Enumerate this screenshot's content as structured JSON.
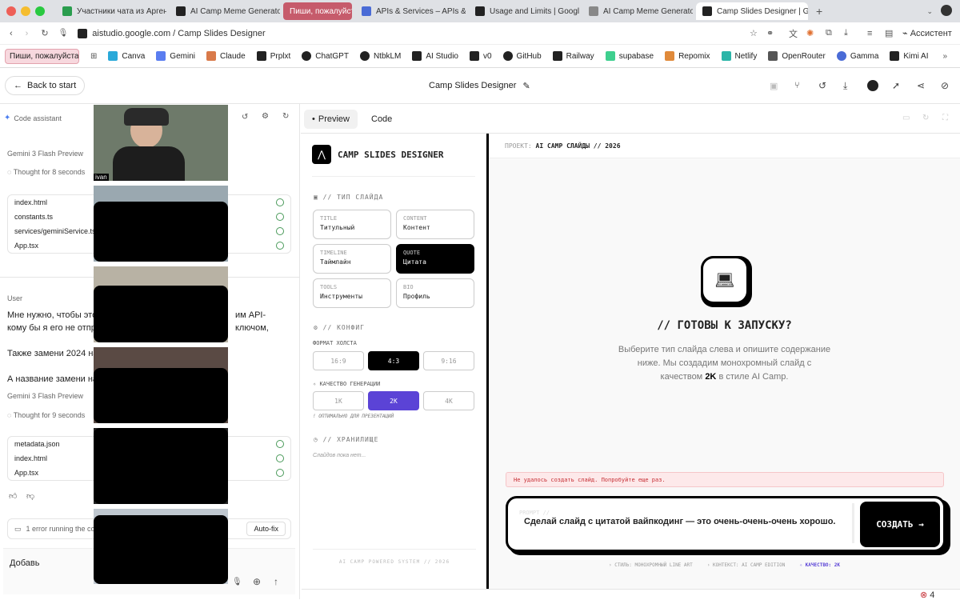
{
  "browser": {
    "tabs": [
      {
        "label": "Участники чата из Аргентин",
        "color": "#2a9d4e"
      },
      {
        "label": "AI Camp Meme Generator | G",
        "color": "#222"
      },
      {
        "label": "Пиши, пожалуйста",
        "color": "#c8324a"
      },
      {
        "label": "APIs & Services – APIs & Se",
        "color": "#4a6bd6"
      },
      {
        "label": "Usage and Limits | Google A",
        "color": "#222"
      },
      {
        "label": "AI Camp Meme Generator",
        "color": "#888"
      },
      {
        "label": "Camp Slides Designer | Goo",
        "color": "#222"
      }
    ],
    "new_tab": "+",
    "url": "aistudio.google.com / Camp Slides Designer",
    "assistant_label": "Ассистент",
    "bookmarks": [
      {
        "label": "Пиши, пожалуйста,...",
        "color": "#f3c9d0"
      },
      {
        "label": "Canva",
        "color": "#2aa9d9"
      },
      {
        "label": "Gemini",
        "color": "#5a7df0"
      },
      {
        "label": "Claude",
        "color": "#d97a4a"
      },
      {
        "label": "Prplxt",
        "color": "#222"
      },
      {
        "label": "ChatGPT",
        "color": "#222"
      },
      {
        "label": "NtbkLM",
        "color": "#222"
      },
      {
        "label": "AI Studio",
        "color": "#222"
      },
      {
        "label": "v0",
        "color": "#222"
      },
      {
        "label": "GitHub",
        "color": "#222"
      },
      {
        "label": "Railway",
        "color": "#222"
      },
      {
        "label": "supabase",
        "color": "#3ecf8e"
      },
      {
        "label": "Repomix",
        "color": "#e08a3a"
      },
      {
        "label": "Netlify",
        "color": "#2bb5a8"
      },
      {
        "label": "OpenRouter",
        "color": "#555"
      },
      {
        "label": "Gamma",
        "color": "#4a6bd6"
      },
      {
        "label": "Kimi AI",
        "color": "#222"
      }
    ]
  },
  "header": {
    "back_label": "Back to start",
    "title": "Camp Slides Designer"
  },
  "left": {
    "code_assistant": "Code assistant",
    "model1": "Gemini 3 Flash Preview",
    "thought1": "Thought for 8 seconds",
    "files1": [
      "index.html",
      "constants.ts",
      "services/geminiService.ts",
      "App.tsx"
    ],
    "user_label": "User",
    "msg1a": "Мне нужно, чтобы это",
    "msg1b": "им API-ключом,",
    "msg2": "кому бы я его не отпра",
    "msg3": "Также замени 2024 на 2026, сейчас 26-й год.",
    "msg4": "А название замени на",
    "model2": "Gemini 3 Flash Preview",
    "thought2": "Thought for 9 seconds",
    "files2": [
      "metadata.json",
      "index.html",
      "App.tsx"
    ],
    "error_text": "1 error running the co",
    "autofix": "Auto-fix",
    "input_value": "Добавь",
    "video_name": "ivan"
  },
  "center": {
    "tab_preview": "Preview",
    "tab_code": "Code",
    "app_title": "CAMP SLIDES DESIGNER",
    "section_type": "// ТИП СЛАЙДА",
    "slide_types": [
      {
        "tag": "TITLE",
        "label": "Титульный"
      },
      {
        "tag": "CONTENT",
        "label": "Контент"
      },
      {
        "tag": "TIMELINE",
        "label": "Таймлайн"
      },
      {
        "tag": "QUOTE",
        "label": "Цитата"
      },
      {
        "tag": "TOOLS",
        "label": "Инструменты"
      },
      {
        "tag": "BIO",
        "label": "Профиль"
      }
    ],
    "section_config": "// КОНФИГ",
    "canvas_label": "ФОРМАТ ХОЛСТА",
    "formats": [
      "16:9",
      "4:3",
      "9:16"
    ],
    "quality_label": "КАЧЕСТВО ГЕНЕРАЦИИ",
    "qualities": [
      "1K",
      "2K",
      "4K"
    ],
    "quality_hint": "! ОПТИМАЛЬНО ДЛЯ ПРЕЗЕНТАЦИЙ",
    "section_storage": "// ХРАНИЛИЩЕ",
    "storage_empty": "Слайдов пока нет...",
    "footer": "AI CAMP POWERED SYSTEM // 2026",
    "project_label": "ПРОЕКТ:",
    "project_value": "AI CAMP СЛАЙДЫ // 2026",
    "ready_title": "// ГОТОВЫ К ЗАПУСКУ?",
    "ready_desc1": "Выберите тип слайда слева и опишите содержание",
    "ready_desc2": "ниже. Мы создадим монохромный слайд с",
    "ready_desc3a": "качеством",
    "ready_desc3b": "2K",
    "ready_desc3c": "в стиле AI Camp.",
    "error_msg": "Не удалось создать слайд. Попробуйте еще раз.",
    "prompt_label": "PROMPT //",
    "prompt_text": "Сделай слайд с цитатой вайпкодинг — это очень-очень-очень хорошо.",
    "create_label": "СОЗДАТЬ →",
    "status_style": "› СТИЛЬ: МОНОХРОМНЫЙ LINE ART",
    "status_context": "› КОНТЕКСТ: AI CAMP EDITION",
    "status_quality": "✧ КАЧЕСТВО: 2K",
    "error_count": "4"
  }
}
